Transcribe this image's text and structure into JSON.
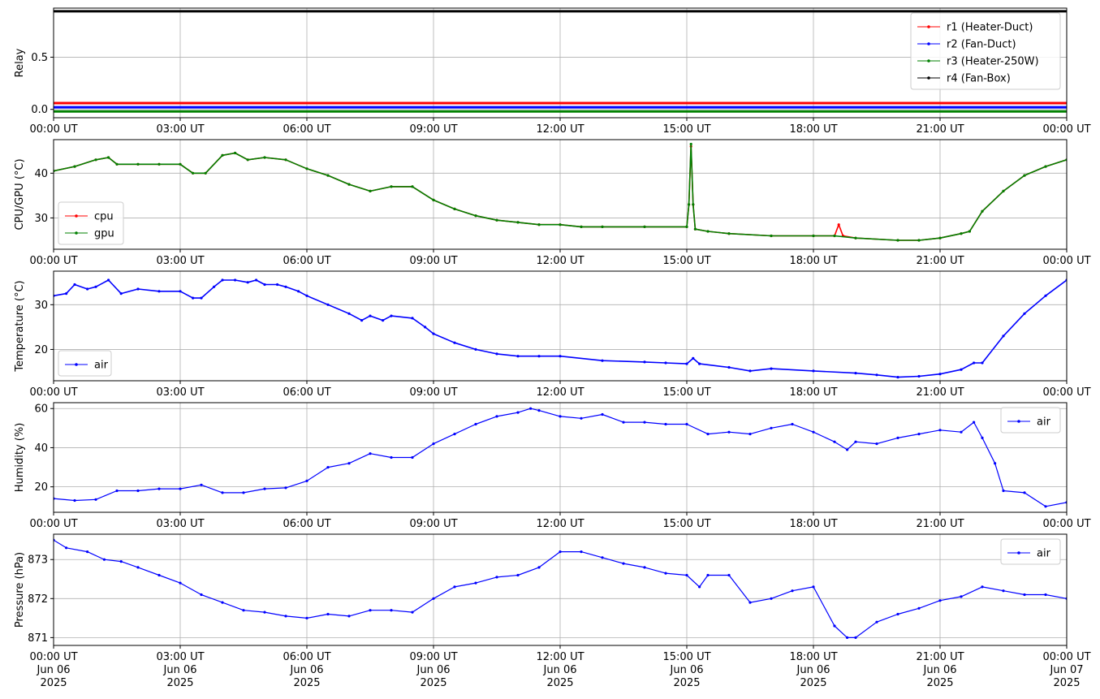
{
  "chart_data": [
    {
      "type": "line",
      "ylabel": "Relay",
      "ylim": [
        -0.08,
        0.97
      ],
      "yticks": [
        {
          "v": 0.0,
          "label": "0.0"
        },
        {
          "v": 0.5,
          "label": "0.5"
        }
      ],
      "legend": "top-right",
      "grid": true,
      "series": [
        {
          "name": "r1 (Heater-Duct)",
          "color": "#ff0000",
          "x": [
            0,
            24
          ],
          "y": [
            0.06,
            0.06
          ]
        },
        {
          "name": "r2 (Fan-Duct)",
          "color": "#0000ff",
          "x": [
            0,
            24
          ],
          "y": [
            0.02,
            0.02
          ]
        },
        {
          "name": "r3 (Heater-250W)",
          "color": "#008000",
          "x": [
            0,
            24
          ],
          "y": [
            -0.02,
            -0.02
          ]
        },
        {
          "name": "r4 (Fan-Box)",
          "color": "#000000",
          "x": [
            0,
            24
          ],
          "y": [
            0.94,
            0.94
          ]
        }
      ]
    },
    {
      "type": "line",
      "ylabel": "CPU/GPU (°C)",
      "ylim": [
        23,
        47.5
      ],
      "yticks": [
        {
          "v": 30,
          "label": "30"
        },
        {
          "v": 40,
          "label": "40"
        }
      ],
      "legend": "bottom-left",
      "grid": true,
      "series": [
        {
          "name": "cpu",
          "color": "#ff0000",
          "x": [
            0,
            0.5,
            1.0,
            1.3,
            1.5,
            2.0,
            2.5,
            3.0,
            3.3,
            3.6,
            4.0,
            4.3,
            4.6,
            5.0,
            5.5,
            6.0,
            6.5,
            7.0,
            7.5,
            8.0,
            8.5,
            9.0,
            9.5,
            10.0,
            10.5,
            11.0,
            11.5,
            12.0,
            12.5,
            13.0,
            14.0,
            15.0,
            15.05,
            15.1,
            15.15,
            15.2,
            15.5,
            16.0,
            17.0,
            18.0,
            18.5,
            18.6,
            18.7,
            19.0,
            20.0,
            20.5,
            21.0,
            21.5,
            21.7,
            22.0,
            22.5,
            23.0,
            23.5,
            24.0
          ],
          "y": [
            40.5,
            41.5,
            43,
            43.5,
            42,
            42,
            42,
            42,
            40,
            40,
            44,
            44.5,
            43,
            43.5,
            43,
            41,
            39.5,
            37.5,
            36,
            37,
            37,
            34,
            32,
            30.5,
            29.5,
            29,
            28.5,
            28.5,
            28,
            28,
            28,
            28,
            33,
            46,
            33,
            27.5,
            27,
            26.5,
            26,
            26,
            26,
            28.5,
            26,
            25.5,
            25,
            25,
            25.5,
            26.5,
            27,
            31.5,
            36,
            39.5,
            41.5,
            43
          ]
        },
        {
          "name": "gpu",
          "color": "#008000",
          "x": [
            0,
            0.5,
            1.0,
            1.3,
            1.5,
            2.0,
            2.5,
            3.0,
            3.3,
            3.6,
            4.0,
            4.3,
            4.6,
            5.0,
            5.5,
            6.0,
            6.5,
            7.0,
            7.5,
            8.0,
            8.5,
            9.0,
            9.5,
            10.0,
            10.5,
            11.0,
            11.5,
            12.0,
            12.5,
            13.0,
            14.0,
            15.0,
            15.05,
            15.1,
            15.15,
            15.2,
            15.5,
            16.0,
            17.0,
            18.0,
            18.5,
            19.0,
            20.0,
            20.5,
            21.0,
            21.5,
            21.7,
            22.0,
            22.5,
            23.0,
            23.5,
            24.0
          ],
          "y": [
            40.5,
            41.5,
            43,
            43.5,
            42,
            42,
            42,
            42,
            40,
            40,
            44,
            44.5,
            43,
            43.5,
            43,
            41,
            39.5,
            37.5,
            36,
            37,
            37,
            34,
            32,
            30.5,
            29.5,
            29,
            28.5,
            28.5,
            28,
            28,
            28,
            28,
            33,
            46.5,
            33,
            27.5,
            27,
            26.5,
            26,
            26,
            26,
            25.5,
            25,
            25,
            25.5,
            26.5,
            27,
            31.5,
            36,
            39.5,
            41.5,
            43
          ]
        }
      ]
    },
    {
      "type": "line",
      "ylabel": "Temperature (°C)",
      "ylim": [
        13,
        37.5
      ],
      "yticks": [
        {
          "v": 20,
          "label": "20"
        },
        {
          "v": 30,
          "label": "30"
        }
      ],
      "legend": "bottom-left",
      "grid": true,
      "series": [
        {
          "name": "air",
          "color": "#0000ff",
          "x": [
            0,
            0.3,
            0.5,
            0.8,
            1.0,
            1.3,
            1.6,
            2.0,
            2.5,
            3.0,
            3.3,
            3.5,
            3.8,
            4.0,
            4.3,
            4.6,
            4.8,
            5.0,
            5.3,
            5.5,
            5.8,
            6.0,
            6.5,
            7.0,
            7.3,
            7.5,
            7.8,
            8.0,
            8.5,
            8.8,
            9.0,
            9.5,
            10.0,
            10.5,
            11.0,
            11.5,
            12.0,
            13.0,
            14.0,
            14.5,
            15.0,
            15.15,
            15.3,
            16.0,
            16.5,
            17.0,
            18.0,
            19.0,
            19.5,
            20.0,
            20.5,
            21.0,
            21.5,
            21.8,
            22.0,
            22.5,
            23.0,
            23.5,
            24.0
          ],
          "y": [
            32,
            32.5,
            34.5,
            33.5,
            34,
            35.5,
            32.5,
            33.5,
            33,
            33,
            31.5,
            31.5,
            34,
            35.5,
            35.5,
            35,
            35.5,
            34.5,
            34.5,
            34,
            33,
            32,
            30,
            28,
            26.5,
            27.5,
            26.5,
            27.5,
            27,
            25,
            23.5,
            21.5,
            20,
            19,
            18.5,
            18.5,
            18.5,
            17.5,
            17.2,
            17,
            16.8,
            18,
            16.8,
            16,
            15.2,
            15.7,
            15.2,
            14.7,
            14.3,
            13.8,
            14,
            14.5,
            15.5,
            17,
            17,
            23,
            28,
            32,
            35.5
          ]
        }
      ]
    },
    {
      "type": "scatter",
      "ylabel": "Humidity (%)",
      "ylim": [
        7,
        63
      ],
      "yticks": [
        {
          "v": 20,
          "label": "20"
        },
        {
          "v": 40,
          "label": "40"
        },
        {
          "v": 60,
          "label": "60"
        }
      ],
      "legend": "top-right",
      "grid": true,
      "series": [
        {
          "name": "air",
          "color": "#0000ff",
          "x": [
            0,
            0.5,
            1.0,
            1.5,
            2.0,
            2.5,
            3.0,
            3.5,
            4.0,
            4.5,
            5.0,
            5.5,
            6.0,
            6.5,
            7.0,
            7.5,
            8.0,
            8.5,
            9.0,
            9.5,
            10.0,
            10.5,
            11.0,
            11.3,
            11.5,
            12.0,
            12.5,
            13.0,
            13.5,
            14.0,
            14.5,
            15.0,
            15.5,
            16.0,
            16.5,
            17.0,
            17.5,
            18.0,
            18.5,
            18.8,
            19.0,
            19.5,
            20.0,
            20.5,
            21.0,
            21.5,
            21.8,
            22.0,
            22.3,
            22.5,
            23.0,
            23.5,
            24.0
          ],
          "y": [
            14,
            13,
            13.5,
            18,
            18,
            19,
            19,
            21,
            17,
            17,
            19,
            19.5,
            23,
            30,
            32,
            37,
            35,
            35,
            42,
            47,
            52,
            56,
            58,
            60,
            59,
            56,
            55,
            57,
            53,
            53,
            52,
            52,
            47,
            48,
            47,
            50,
            52,
            48,
            43,
            39,
            43,
            42,
            45,
            47,
            49,
            48,
            53,
            45,
            32,
            18,
            17,
            10,
            12
          ]
        }
      ]
    },
    {
      "type": "scatter",
      "ylabel": "Pressure (hPa)",
      "ylim": [
        870.8,
        873.65
      ],
      "yticks": [
        {
          "v": 871,
          "label": "871"
        },
        {
          "v": 872,
          "label": "872"
        },
        {
          "v": 873,
          "label": "873"
        }
      ],
      "legend": "top-right",
      "grid": true,
      "series": [
        {
          "name": "air",
          "color": "#0000ff",
          "x": [
            0,
            0.3,
            0.8,
            1.2,
            1.6,
            2.0,
            2.5,
            3.0,
            3.5,
            4.0,
            4.5,
            5.0,
            5.5,
            6.0,
            6.5,
            7.0,
            7.5,
            8.0,
            8.5,
            9.0,
            9.5,
            10.0,
            10.5,
            11.0,
            11.5,
            12.0,
            12.5,
            13.0,
            13.5,
            14.0,
            14.5,
            15.0,
            15.3,
            15.5,
            16.0,
            16.5,
            17.0,
            17.5,
            18.0,
            18.5,
            18.8,
            19.0,
            19.5,
            20.0,
            20.5,
            21.0,
            21.5,
            22.0,
            22.5,
            23.0,
            23.5,
            24.0
          ],
          "y": [
            873.5,
            873.3,
            873.2,
            873.0,
            872.95,
            872.8,
            872.6,
            872.4,
            872.1,
            871.9,
            871.7,
            871.65,
            871.55,
            871.5,
            871.6,
            871.55,
            871.7,
            871.7,
            871.65,
            872.0,
            872.3,
            872.4,
            872.55,
            872.6,
            872.8,
            873.2,
            873.2,
            873.05,
            872.9,
            872.8,
            872.65,
            872.6,
            872.3,
            872.6,
            872.6,
            871.9,
            872.0,
            872.2,
            872.3,
            871.3,
            871.0,
            871.0,
            871.4,
            871.6,
            871.75,
            871.95,
            872.05,
            872.3,
            872.2,
            872.1,
            872.1,
            872.0
          ]
        }
      ]
    }
  ],
  "x_axis": {
    "range_hours": [
      0,
      24
    ],
    "tick_hours": [
      0,
      3,
      6,
      9,
      12,
      15,
      18,
      21,
      24
    ],
    "tick_labels": [
      "00:00 UT",
      "03:00 UT",
      "06:00 UT",
      "09:00 UT",
      "12:00 UT",
      "15:00 UT",
      "18:00 UT",
      "21:00 UT",
      "00:00 UT"
    ],
    "date_labels": [
      "Jun 06",
      "Jun 06",
      "Jun 06",
      "Jun 06",
      "Jun 06",
      "Jun 06",
      "Jun 06",
      "Jun 06",
      "Jun 07"
    ],
    "year_labels": [
      "2025",
      "2025",
      "2025",
      "2025",
      "2025",
      "2025",
      "2025",
      "2025",
      "2025"
    ]
  }
}
